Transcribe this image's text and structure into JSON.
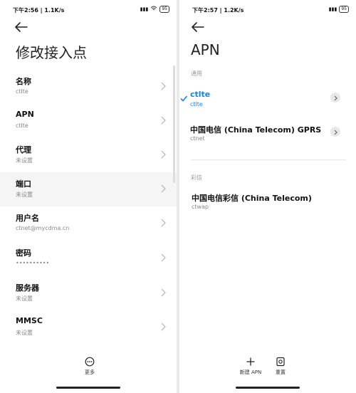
{
  "left": {
    "status": {
      "time": "下午2:56 | 1.1K/s",
      "signal": "▮▮▮",
      "battery": "95"
    },
    "title": "修改接入点",
    "fields": [
      {
        "label": "名称",
        "value": "ctlte"
      },
      {
        "label": "APN",
        "value": "ctlte"
      },
      {
        "label": "代理",
        "value": "未设置"
      },
      {
        "label": "端口",
        "value": "未设置"
      },
      {
        "label": "用户名",
        "value": "ctnet@mycdma.cn"
      },
      {
        "label": "密码",
        "value": "••••••••••"
      },
      {
        "label": "服务器",
        "value": "未设置"
      },
      {
        "label": "MMSC",
        "value": "未设置"
      }
    ],
    "more_label": "更多"
  },
  "right": {
    "status": {
      "time": "下午2:57 | 1.2K/s",
      "signal": "▮▮▮",
      "battery": "95"
    },
    "title": "APN",
    "section_general": "通用",
    "section_mms": "彩信",
    "apns": [
      {
        "name": "ctlte",
        "apn": "ctlte",
        "selected": true
      },
      {
        "name": "中国电信 (China Telecom) GPRS",
        "apn": "ctnet",
        "selected": false
      },
      {
        "name": "中国电信彩信 (China Telecom)",
        "apn": "ctwap",
        "selected": false
      }
    ],
    "new_apn_label": "新建 APN",
    "reset_label": "重置"
  },
  "colors": {
    "accent": "#1a82d6",
    "secondary_text": "#888888"
  }
}
